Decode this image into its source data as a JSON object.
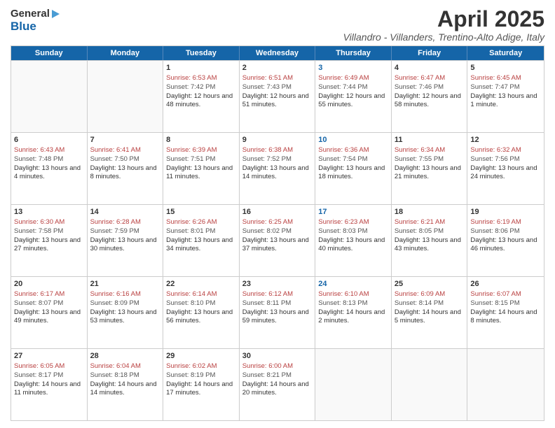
{
  "header": {
    "logo_general": "General",
    "logo_blue": "Blue",
    "month_title": "April 2025",
    "location": "Villandro - Villanders, Trentino-Alto Adige, Italy"
  },
  "days_of_week": [
    "Sunday",
    "Monday",
    "Tuesday",
    "Wednesday",
    "Thursday",
    "Friday",
    "Saturday"
  ],
  "rows": [
    [
      {
        "day": "",
        "sunrise": "",
        "sunset": "",
        "daylight": "",
        "empty": true
      },
      {
        "day": "",
        "sunrise": "",
        "sunset": "",
        "daylight": "",
        "empty": true
      },
      {
        "day": "1",
        "sunrise": "Sunrise: 6:53 AM",
        "sunset": "Sunset: 7:42 PM",
        "daylight": "Daylight: 12 hours and 48 minutes."
      },
      {
        "day": "2",
        "sunrise": "Sunrise: 6:51 AM",
        "sunset": "Sunset: 7:43 PM",
        "daylight": "Daylight: 12 hours and 51 minutes."
      },
      {
        "day": "3",
        "sunrise": "Sunrise: 6:49 AM",
        "sunset": "Sunset: 7:44 PM",
        "daylight": "Daylight: 12 hours and 55 minutes.",
        "thursday": true
      },
      {
        "day": "4",
        "sunrise": "Sunrise: 6:47 AM",
        "sunset": "Sunset: 7:46 PM",
        "daylight": "Daylight: 12 hours and 58 minutes."
      },
      {
        "day": "5",
        "sunrise": "Sunrise: 6:45 AM",
        "sunset": "Sunset: 7:47 PM",
        "daylight": "Daylight: 13 hours and 1 minute."
      }
    ],
    [
      {
        "day": "6",
        "sunrise": "Sunrise: 6:43 AM",
        "sunset": "Sunset: 7:48 PM",
        "daylight": "Daylight: 13 hours and 4 minutes."
      },
      {
        "day": "7",
        "sunrise": "Sunrise: 6:41 AM",
        "sunset": "Sunset: 7:50 PM",
        "daylight": "Daylight: 13 hours and 8 minutes."
      },
      {
        "day": "8",
        "sunrise": "Sunrise: 6:39 AM",
        "sunset": "Sunset: 7:51 PM",
        "daylight": "Daylight: 13 hours and 11 minutes."
      },
      {
        "day": "9",
        "sunrise": "Sunrise: 6:38 AM",
        "sunset": "Sunset: 7:52 PM",
        "daylight": "Daylight: 13 hours and 14 minutes."
      },
      {
        "day": "10",
        "sunrise": "Sunrise: 6:36 AM",
        "sunset": "Sunset: 7:54 PM",
        "daylight": "Daylight: 13 hours and 18 minutes.",
        "thursday": true
      },
      {
        "day": "11",
        "sunrise": "Sunrise: 6:34 AM",
        "sunset": "Sunset: 7:55 PM",
        "daylight": "Daylight: 13 hours and 21 minutes."
      },
      {
        "day": "12",
        "sunrise": "Sunrise: 6:32 AM",
        "sunset": "Sunset: 7:56 PM",
        "daylight": "Daylight: 13 hours and 24 minutes."
      }
    ],
    [
      {
        "day": "13",
        "sunrise": "Sunrise: 6:30 AM",
        "sunset": "Sunset: 7:58 PM",
        "daylight": "Daylight: 13 hours and 27 minutes."
      },
      {
        "day": "14",
        "sunrise": "Sunrise: 6:28 AM",
        "sunset": "Sunset: 7:59 PM",
        "daylight": "Daylight: 13 hours and 30 minutes."
      },
      {
        "day": "15",
        "sunrise": "Sunrise: 6:26 AM",
        "sunset": "Sunset: 8:01 PM",
        "daylight": "Daylight: 13 hours and 34 minutes."
      },
      {
        "day": "16",
        "sunrise": "Sunrise: 6:25 AM",
        "sunset": "Sunset: 8:02 PM",
        "daylight": "Daylight: 13 hours and 37 minutes."
      },
      {
        "day": "17",
        "sunrise": "Sunrise: 6:23 AM",
        "sunset": "Sunset: 8:03 PM",
        "daylight": "Daylight: 13 hours and 40 minutes.",
        "thursday": true
      },
      {
        "day": "18",
        "sunrise": "Sunrise: 6:21 AM",
        "sunset": "Sunset: 8:05 PM",
        "daylight": "Daylight: 13 hours and 43 minutes."
      },
      {
        "day": "19",
        "sunrise": "Sunrise: 6:19 AM",
        "sunset": "Sunset: 8:06 PM",
        "daylight": "Daylight: 13 hours and 46 minutes."
      }
    ],
    [
      {
        "day": "20",
        "sunrise": "Sunrise: 6:17 AM",
        "sunset": "Sunset: 8:07 PM",
        "daylight": "Daylight: 13 hours and 49 minutes."
      },
      {
        "day": "21",
        "sunrise": "Sunrise: 6:16 AM",
        "sunset": "Sunset: 8:09 PM",
        "daylight": "Daylight: 13 hours and 53 minutes."
      },
      {
        "day": "22",
        "sunrise": "Sunrise: 6:14 AM",
        "sunset": "Sunset: 8:10 PM",
        "daylight": "Daylight: 13 hours and 56 minutes."
      },
      {
        "day": "23",
        "sunrise": "Sunrise: 6:12 AM",
        "sunset": "Sunset: 8:11 PM",
        "daylight": "Daylight: 13 hours and 59 minutes."
      },
      {
        "day": "24",
        "sunrise": "Sunrise: 6:10 AM",
        "sunset": "Sunset: 8:13 PM",
        "daylight": "Daylight: 14 hours and 2 minutes.",
        "thursday": true
      },
      {
        "day": "25",
        "sunrise": "Sunrise: 6:09 AM",
        "sunset": "Sunset: 8:14 PM",
        "daylight": "Daylight: 14 hours and 5 minutes."
      },
      {
        "day": "26",
        "sunrise": "Sunrise: 6:07 AM",
        "sunset": "Sunset: 8:15 PM",
        "daylight": "Daylight: 14 hours and 8 minutes."
      }
    ],
    [
      {
        "day": "27",
        "sunrise": "Sunrise: 6:05 AM",
        "sunset": "Sunset: 8:17 PM",
        "daylight": "Daylight: 14 hours and 11 minutes."
      },
      {
        "day": "28",
        "sunrise": "Sunrise: 6:04 AM",
        "sunset": "Sunset: 8:18 PM",
        "daylight": "Daylight: 14 hours and 14 minutes."
      },
      {
        "day": "29",
        "sunrise": "Sunrise: 6:02 AM",
        "sunset": "Sunset: 8:19 PM",
        "daylight": "Daylight: 14 hours and 17 minutes."
      },
      {
        "day": "30",
        "sunrise": "Sunrise: 6:00 AM",
        "sunset": "Sunset: 8:21 PM",
        "daylight": "Daylight: 14 hours and 20 minutes."
      },
      {
        "day": "",
        "sunrise": "",
        "sunset": "",
        "daylight": "",
        "empty": true
      },
      {
        "day": "",
        "sunrise": "",
        "sunset": "",
        "daylight": "",
        "empty": true
      },
      {
        "day": "",
        "sunrise": "",
        "sunset": "",
        "daylight": "",
        "empty": true
      }
    ]
  ]
}
